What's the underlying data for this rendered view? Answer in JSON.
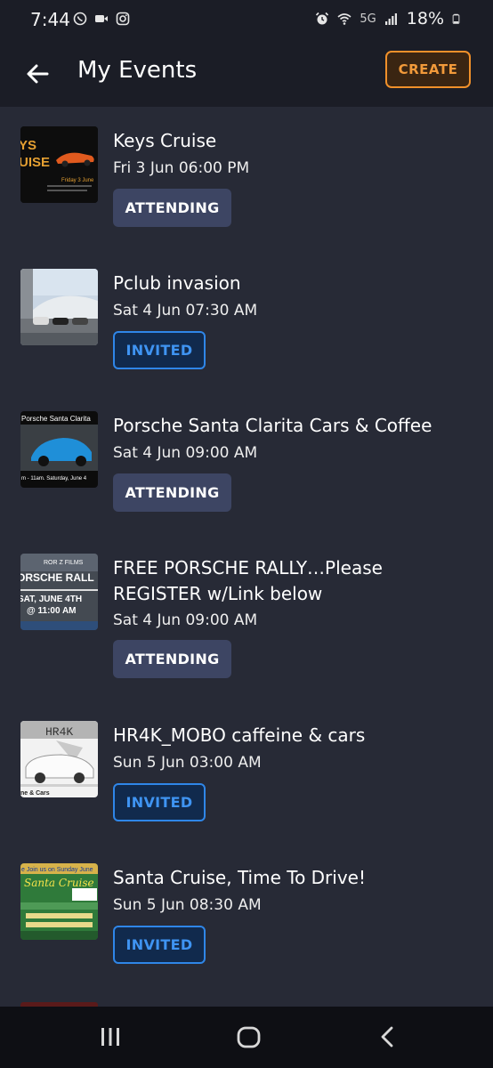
{
  "status_bar": {
    "time": "7:44",
    "network": "5G",
    "battery": "18%",
    "icons": [
      "whatsapp-icon",
      "video-icon",
      "instagram-icon",
      "alarm-icon",
      "wifi-icon",
      "signal-icon",
      "battery-icon"
    ]
  },
  "header": {
    "title": "My Events",
    "create_label": "CREATE"
  },
  "colors": {
    "background": "#272a36",
    "header_bg": "#1b1d26",
    "accent_orange": "#f0902a",
    "invited_blue": "#2f86e8",
    "attending_pill": "#3d4563"
  },
  "events": [
    {
      "title": "Keys Cruise",
      "date": "Fri 3 Jun 06:00 PM",
      "status": "ATTENDING",
      "thumb_text": "KEYS CRUISE",
      "thumb_caption": "Friday 3 June"
    },
    {
      "title": "Pclub invasion",
      "date": "Sat 4 Jun 07:30 AM",
      "status": "INVITED",
      "thumb_text": "",
      "thumb_caption": ""
    },
    {
      "title": "Porsche Santa Clarita Cars & Coffee",
      "date": "Sat 4 Jun 09:00 AM",
      "status": "ATTENDING",
      "thumb_text": "Porsche Santa Clarita",
      "thumb_caption": "m - 11am. Saturday, June 4"
    },
    {
      "title": "FREE PORSCHE RALLY…Please REGISTER w/Link below",
      "date": "Sat 4 Jun 09:00 AM",
      "status": "ATTENDING",
      "thumb_text": "ORSCHE RALL",
      "thumb_caption": "SAT, JUNE 4TH @ 11:00 AM",
      "thumb_top": "ROR Z FILMS"
    },
    {
      "title": "HR4K_MOBO caffeine & cars",
      "date": "Sun 5 Jun 03:00 AM",
      "status": "INVITED",
      "thumb_text": "HR4K",
      "thumb_caption": "ne & Cars"
    },
    {
      "title": "Santa Cruise, Time To Drive!",
      "date": "Sun 5 Jun 08:30 AM",
      "status": "INVITED",
      "thumb_text": "Santa Cruise",
      "thumb_caption": "e Join us on Sunday June"
    }
  ]
}
